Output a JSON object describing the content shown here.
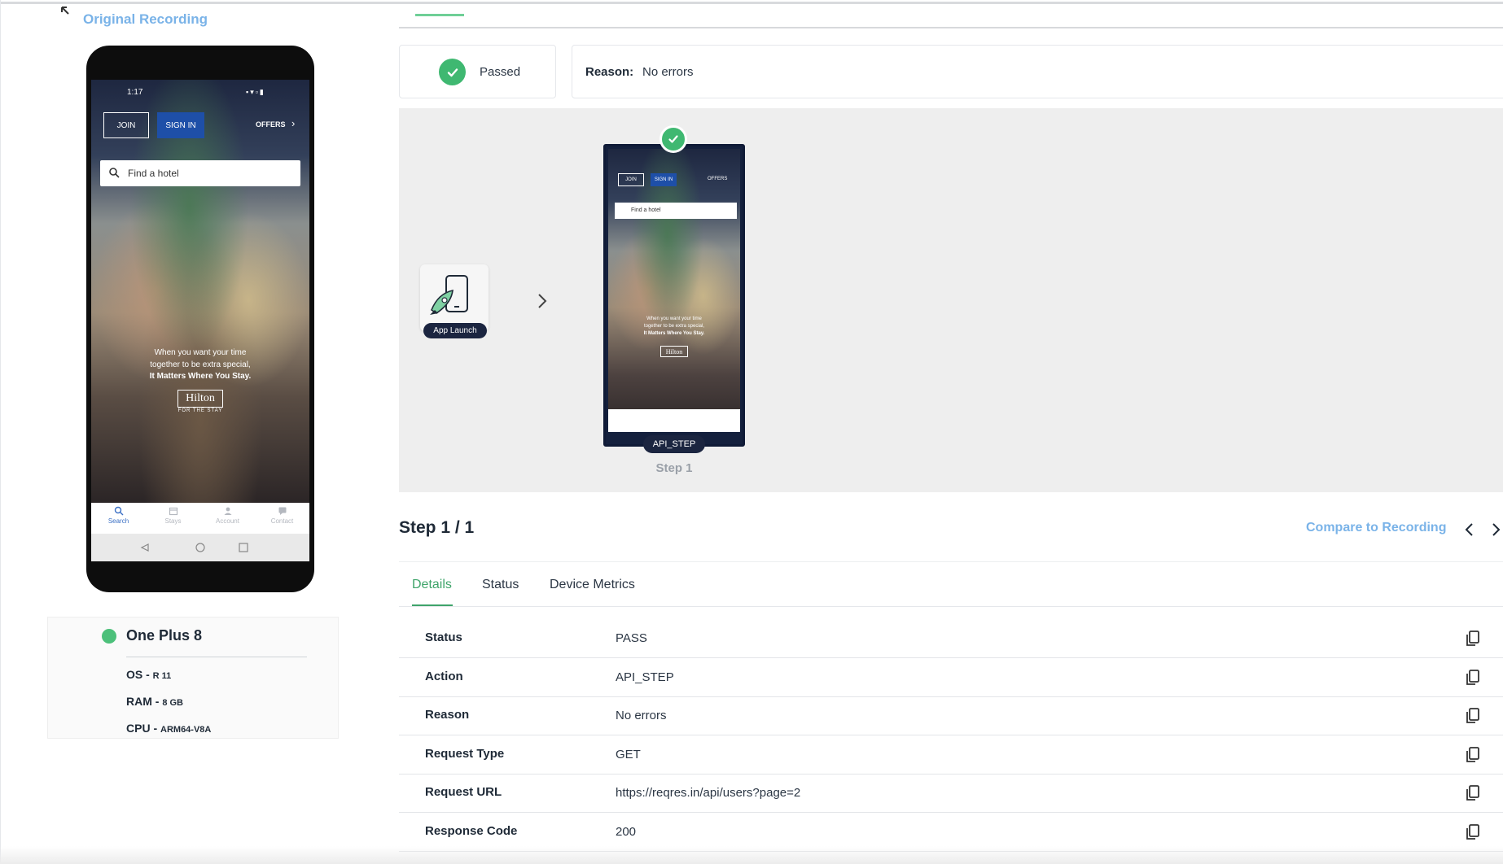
{
  "header": {
    "title": "Original Recording"
  },
  "phone": {
    "status_time": "1:17",
    "status_icons": "▪▾▫▮",
    "join_label": "JOIN",
    "signin_label": "SIGN IN",
    "offers_label": "OFFERS",
    "search_placeholder": "Find a hotel",
    "tagline_1": "When you want your time",
    "tagline_2": "together to be extra special,",
    "tagline_3": "It Matters Where You Stay.",
    "brand": "Hilton",
    "brand_sub": "FOR THE STAY",
    "nav": [
      "Search",
      "Stays",
      "Account",
      "Contact"
    ]
  },
  "device": {
    "name": "One Plus 8",
    "status_color": "#4cc07a",
    "os_label": "OS -",
    "os_value": "R 11",
    "ram_label": "RAM -",
    "ram_value": "8 GB",
    "cpu_label": "CPU -",
    "cpu_value": "ARM64-V8A"
  },
  "result": {
    "status": "Passed",
    "reason_label": "Reason:",
    "reason_value": "No errors"
  },
  "flow": {
    "launch_label": "App Launch",
    "step_action": "API_STEP",
    "step_caption": "Step 1"
  },
  "details": {
    "step_title": "Step 1 / 1",
    "compare_label": "Compare to Recording",
    "tabs": [
      "Details",
      "Status",
      "Device Metrics"
    ],
    "active_tab": "Details",
    "rows": [
      {
        "label": "Status",
        "value": "PASS"
      },
      {
        "label": "Action",
        "value": "API_STEP"
      },
      {
        "label": "Reason",
        "value": "No errors"
      },
      {
        "label": "Request Type",
        "value": "GET"
      },
      {
        "label": "Request URL",
        "value": "https://reqres.in/api/users?page=2"
      },
      {
        "label": "Response Code",
        "value": "200"
      }
    ]
  },
  "colors": {
    "accent_green": "#3fb871",
    "link_blue": "#7ab3e8",
    "dark_navy": "#1b2540"
  }
}
